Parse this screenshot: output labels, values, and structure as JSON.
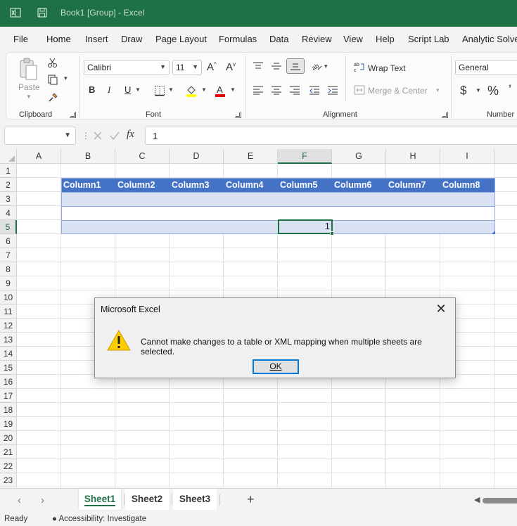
{
  "window": {
    "title": "Book1  [Group]  -  Excel",
    "accent_color": "#1e7145"
  },
  "menu": {
    "tabs": [
      "File",
      "Home",
      "Insert",
      "Draw",
      "Page Layout",
      "Formulas",
      "Data",
      "Review",
      "View",
      "Help",
      "Script Lab",
      "Analytic Solve"
    ],
    "active": "Home"
  },
  "ribbon": {
    "clipboard": {
      "label": "Clipboard",
      "paste_label": "Paste"
    },
    "font": {
      "label": "Font",
      "family": "Calibri",
      "size": "11",
      "bold": "B",
      "italic": "I",
      "underline": "U",
      "grow": "A",
      "shrink": "A"
    },
    "alignment": {
      "label": "Alignment",
      "wrap_text": "Wrap Text",
      "merge_center": "Merge & Center"
    },
    "number": {
      "label": "Number",
      "format": "General",
      "currency": "$",
      "percent": "%"
    }
  },
  "formula_bar": {
    "name_box": "",
    "fx": "fx",
    "value": "1"
  },
  "grid": {
    "columns": [
      "A",
      "B",
      "C",
      "D",
      "E",
      "F",
      "G",
      "H",
      "I"
    ],
    "selected_column": "F",
    "rows": [
      "1",
      "2",
      "3",
      "4",
      "5",
      "6",
      "7",
      "8",
      "9",
      "10",
      "11",
      "12",
      "13",
      "14",
      "15",
      "16",
      "17",
      "18",
      "19",
      "20",
      "21",
      "22",
      "23"
    ],
    "selected_row": "5",
    "table_headers": [
      "Column1",
      "Column2",
      "Column3",
      "Column4",
      "Column5",
      "Column6",
      "Column7",
      "Column8"
    ],
    "table_header_color": "#4472c4",
    "table_band_color": "#d9e1f2",
    "active_cell": {
      "ref": "F5",
      "value": "1"
    }
  },
  "dialog": {
    "title": "Microsoft Excel",
    "message": "Cannot make changes to a table or XML mapping when multiple sheets are selected.",
    "ok_label": "OK",
    "icon": "warning-icon"
  },
  "sheets": {
    "tabs": [
      "Sheet1",
      "Sheet2",
      "Sheet3"
    ],
    "active": "Sheet1",
    "add_label": "+"
  },
  "status": {
    "ready": "Ready",
    "accessibility": "Accessibility: Investigate"
  }
}
